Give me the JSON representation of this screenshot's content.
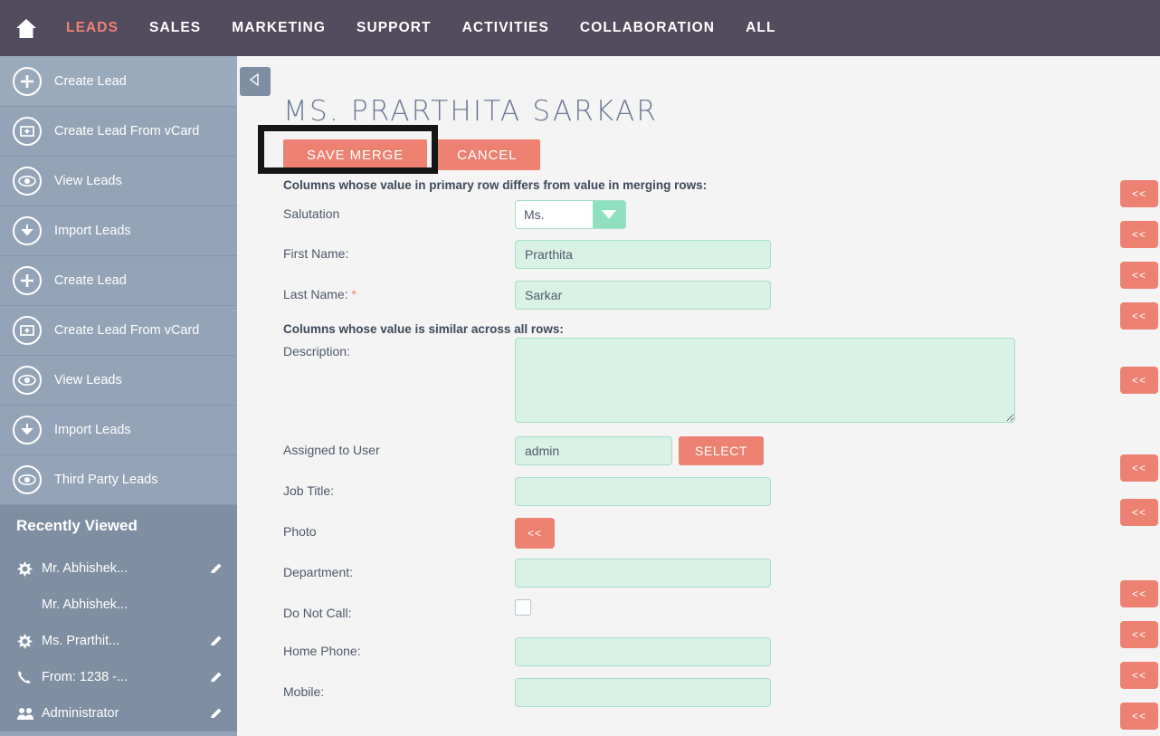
{
  "topnav": {
    "home_icon": "home-icon",
    "items": [
      {
        "label": "LEADS",
        "active": true
      },
      {
        "label": "SALES",
        "active": false
      },
      {
        "label": "MARKETING",
        "active": false
      },
      {
        "label": "SUPPORT",
        "active": false
      },
      {
        "label": "ACTIVITIES",
        "active": false
      },
      {
        "label": "COLLABORATION",
        "active": false
      },
      {
        "label": "ALL",
        "active": false
      }
    ],
    "active_color": "#ed8273",
    "bg_color": "#534b5e"
  },
  "sidebar": {
    "bg_color": "#93a4b8",
    "items": [
      {
        "label": "Create Lead",
        "icon": "plus-circle-icon"
      },
      {
        "label": "Create Lead From vCard",
        "icon": "card-plus-icon"
      },
      {
        "label": "View Leads",
        "icon": "eye-icon"
      },
      {
        "label": "Import Leads",
        "icon": "download-arrow-icon"
      },
      {
        "label": "Create Lead",
        "icon": "plus-circle-icon"
      },
      {
        "label": "Create Lead From vCard",
        "icon": "card-plus-icon"
      },
      {
        "label": "View Leads",
        "icon": "eye-icon"
      },
      {
        "label": "Import Leads",
        "icon": "download-arrow-icon"
      },
      {
        "label": "Third Party Leads",
        "icon": "eye-icon"
      }
    ],
    "recently_viewed": {
      "title": "Recently Viewed",
      "bg_color": "#7e8fa3",
      "entries": [
        {
          "label": "Mr. Abhishek...",
          "icon": "star-burst-icon",
          "indent": false,
          "edit": true
        },
        {
          "label": "Mr. Abhishek...",
          "icon": "none",
          "indent": true,
          "edit": false
        },
        {
          "label": "Ms. Prarthit...",
          "icon": "star-burst-icon",
          "indent": false,
          "edit": true
        },
        {
          "label": "From: 1238 -...",
          "icon": "phone-icon",
          "indent": false,
          "edit": true
        },
        {
          "label": "Administrator",
          "icon": "users-icon",
          "indent": false,
          "edit": true
        }
      ]
    }
  },
  "main": {
    "collapse_icon": "left-triangle-icon",
    "page_title": "MS. PRARTHITA SARKAR",
    "buttons": {
      "save_merge": "SAVE MERGE",
      "cancel": "CANCEL"
    },
    "highlight": {
      "color": "#161616",
      "target": "save-merge-button"
    },
    "section_differs": "Columns whose value in primary row differs from value in merging rows:",
    "section_similar": "Columns whose value is similar across all rows:",
    "fields": [
      {
        "label": "Salutation",
        "type": "select",
        "value": "Ms."
      },
      {
        "label": "First Name:",
        "type": "text",
        "value": "Prarthita"
      },
      {
        "label": "Last Name:",
        "type": "text",
        "value": "Sarkar",
        "required": true,
        "required_mark": "*"
      },
      {
        "label": "Description:",
        "type": "textarea",
        "value": ""
      },
      {
        "label": "Assigned to User",
        "type": "text-with-button",
        "value": "admin",
        "button": "SELECT"
      },
      {
        "label": "Job Title:",
        "type": "text",
        "value": ""
      },
      {
        "label": "Photo",
        "type": "button",
        "button": "<<"
      },
      {
        "label": "Department:",
        "type": "text",
        "value": ""
      },
      {
        "label": "Do Not Call:",
        "type": "checkbox",
        "checked": false
      },
      {
        "label": "Home Phone:",
        "type": "text",
        "value": ""
      },
      {
        "label": "Mobile:",
        "type": "text",
        "value": ""
      }
    ],
    "copy_buttons_label": "<<",
    "accent_color": "#ed8273",
    "field_bg_color": "#d9f2e6"
  }
}
